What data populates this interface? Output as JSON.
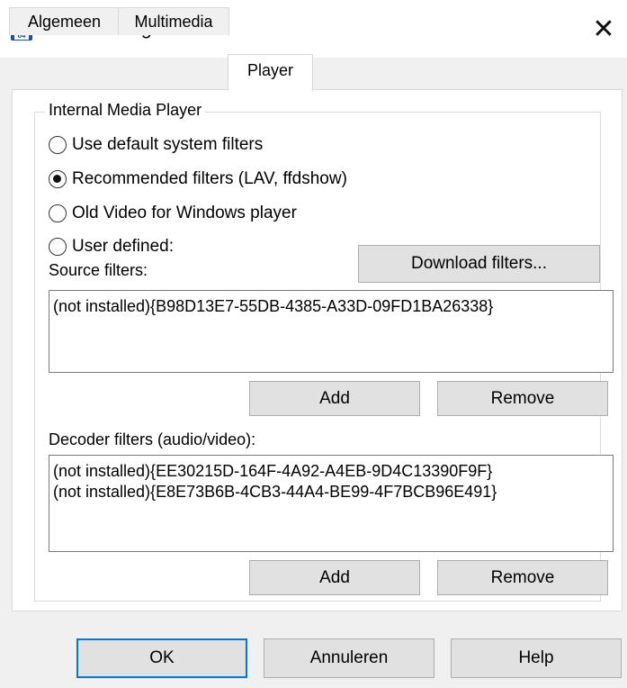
{
  "window": {
    "title": "Lister configureren",
    "close_glyph": "✕",
    "icon": "floppy-disk-64-icon",
    "icon_text": "64"
  },
  "tabs": [
    {
      "label": "Algemeen",
      "active": false
    },
    {
      "label": "Multimedia",
      "active": false
    },
    {
      "label": "Player",
      "active": true
    }
  ],
  "player": {
    "group_title": "Internal Media Player",
    "options": [
      {
        "label": "Use default system filters",
        "checked": false
      },
      {
        "label": "Recommended filters (LAV, ffdshow)",
        "checked": true
      },
      {
        "label": "Old Video for Windows player",
        "checked": false
      },
      {
        "label": "User defined:",
        "checked": false
      }
    ],
    "download_button": "Download filters...",
    "source_filters": {
      "label": "Source filters:",
      "items": [
        "(not installed){B98D13E7-55DB-4385-A33D-09FD1BA26338}"
      ],
      "add_label": "Add",
      "remove_label": "Remove"
    },
    "decoder_filters": {
      "label": "Decoder filters (audio/video):",
      "items": [
        "(not installed){EE30215D-164F-4A92-A4EB-9D4C13390F9F}",
        "(not installed){E8E73B6B-4CB3-44A4-BE99-4F7BCB96E491}"
      ],
      "add_label": "Add",
      "remove_label": "Remove"
    }
  },
  "footer": {
    "ok_label": "OK",
    "cancel_label": "Annuleren",
    "help_label": "Help"
  },
  "colors": {
    "accent": "#0078d7",
    "button_face": "#e1e1e1",
    "dialog_bg": "#f0f0f0"
  }
}
